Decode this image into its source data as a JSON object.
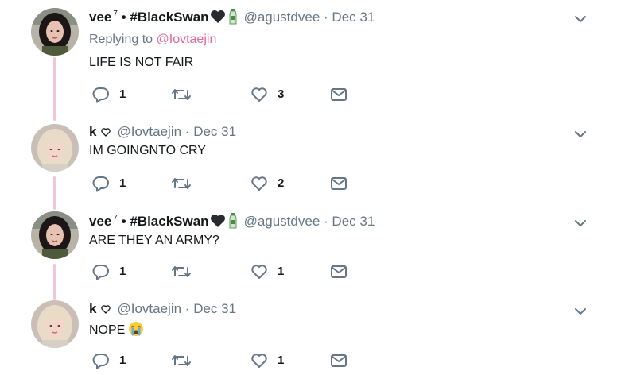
{
  "tweets": [
    {
      "display_name": "vee",
      "name_sup": "7",
      "name_extra": " • #BlackSwan",
      "handle": "@agustdvee",
      "separator": "·",
      "date": "Dec 31",
      "replying_prefix": "Replying to ",
      "replying_handle": "@Iovtaejin",
      "text": "LIFE IS NOT FAIR",
      "replies": "1",
      "retweets": "",
      "likes": "3"
    },
    {
      "display_name": "k",
      "handle": "@Iovtaejin",
      "separator": "·",
      "date": "Dec 31",
      "text": "IM GOINGNTO CRY",
      "replies": "1",
      "retweets": "",
      "likes": "2"
    },
    {
      "display_name": "vee",
      "name_sup": "7",
      "name_extra": " • #BlackSwan",
      "handle": "@agustdvee",
      "separator": "·",
      "date": "Dec 31",
      "text": "ARE THEY AN ARMY?",
      "replies": "1",
      "retweets": "",
      "likes": "1"
    },
    {
      "display_name": "k",
      "handle": "@Iovtaejin",
      "separator": "·",
      "date": "Dec 31",
      "text": "NOPE",
      "text_emoji": "loudly-crying-face",
      "replies": "1",
      "retweets": "",
      "likes": "1"
    }
  ],
  "icons": {
    "reply": "reply-icon",
    "retweet": "retweet-icon",
    "like": "heart-icon",
    "dm": "envelope-icon",
    "caret": "chevron-down-icon"
  },
  "colors": {
    "text": "#14171a",
    "muted": "#657786",
    "link_pink": "#e0689a",
    "thread_line": "#f3c6d2",
    "icon": "#657786"
  }
}
